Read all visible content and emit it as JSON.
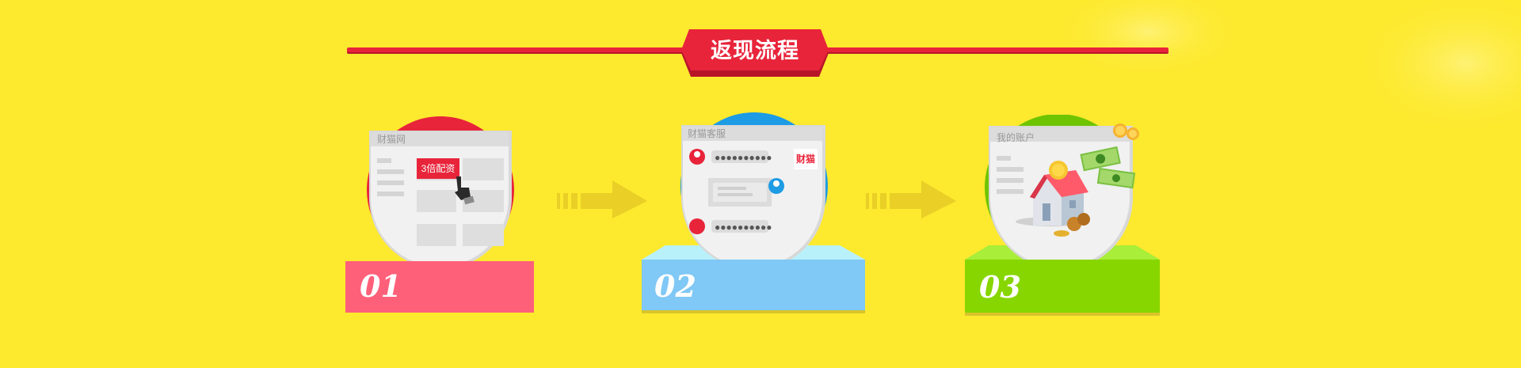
{
  "title": "返现流程",
  "colors": {
    "background": "#fde92e",
    "title_red": "#e8243a",
    "step1": "#ff6079",
    "step2": "#80c8f6",
    "step3": "#87d600"
  },
  "steps": [
    {
      "number": "01",
      "panel_title": "财猫网",
      "button_text": "3倍配资",
      "icon": "hand-pointer-icon"
    },
    {
      "number": "02",
      "panel_title": "财猫客服",
      "brand_text": "财猫",
      "icon": "chat-icon"
    },
    {
      "number": "03",
      "panel_title": "我的账户",
      "icon": "house-money-icon"
    }
  ]
}
